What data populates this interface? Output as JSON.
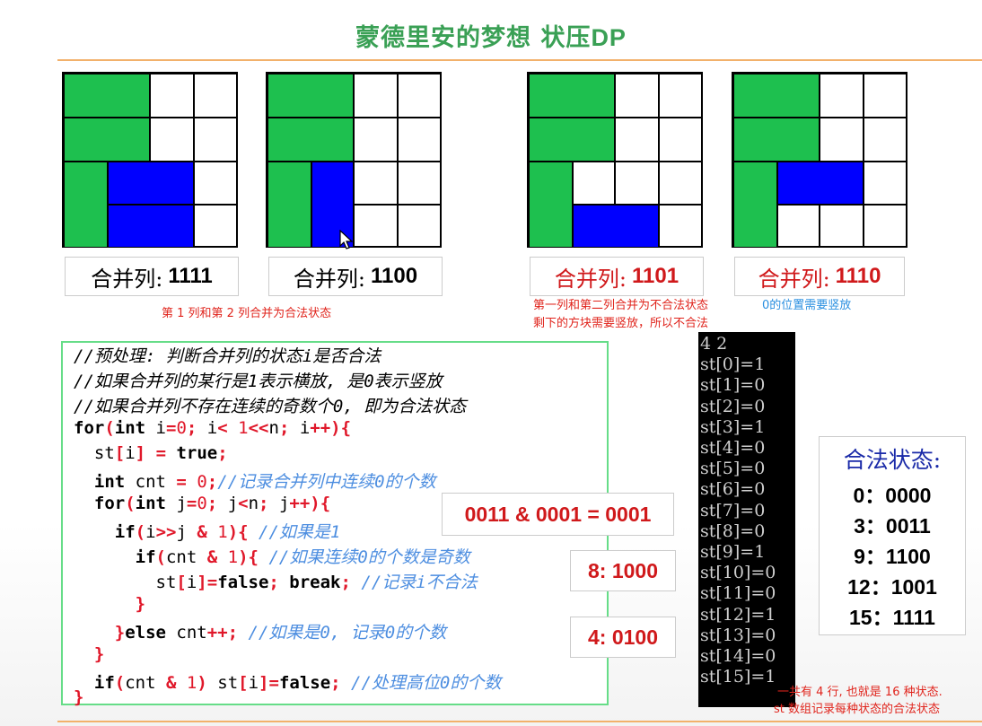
{
  "slide": {
    "title_prefix": "蒙德里安的梦想 状压",
    "title_suffix": "DP"
  },
  "grids": [
    {
      "label_prefix": "合并列:",
      "label_value": "1111",
      "label_color": "#000000"
    },
    {
      "label_prefix": "合并列:",
      "label_value": "1100",
      "label_color": "#000000"
    },
    {
      "label_prefix": "合并列:",
      "label_value": "1101",
      "label_color": "#d0191b"
    },
    {
      "label_prefix": "合并列:",
      "label_value": "1110",
      "label_color": "#d0191b"
    }
  ],
  "colors": {
    "green": "#1ec04f",
    "blue": "#0000ff",
    "accent_red": "#d0191b"
  },
  "notes": {
    "legal_merge": "第 1 列和第 2 列合并为合法状态",
    "illegal_line1": "第一列和第二列合并为不合法状态",
    "illegal_line2": "剩下的方块需要竖放，所以不合法",
    "zero_vertical": "0的位置需要竖放",
    "summary_line1": "一共有 4 行, 也就是 16 种状态.",
    "summary_line2": "st 数组记录每种状态的合法状态"
  },
  "code": {
    "c1": "//预处理: 判断合并列的状态i是否合法",
    "c2": "//如果合并列的某行是1表示横放, 是0表示竖放",
    "c3": "//如果合并列不存在连续的奇数个0, 即为合法状态",
    "c_cnt": "//记录合并列中连续0的个数",
    "c_if1": "//如果是1",
    "c_odd": "//如果连续0的个数是奇数",
    "c_illegal": "//记录i不合法",
    "c_zero": "//如果是0, 记录0的个数",
    "c_high": "//处理高位0的个数"
  },
  "console": {
    "header": "4 2",
    "lines": [
      "st[0]=1",
      "st[1]=0",
      "st[2]=0",
      "st[3]=1",
      "st[4]=0",
      "st[5]=0",
      "st[6]=0",
      "st[7]=0",
      "st[8]=0",
      "st[9]=1",
      "st[10]=0",
      "st[11]=0",
      "st[12]=1",
      "st[13]=0",
      "st[14]=0",
      "st[15]=1"
    ]
  },
  "callouts": {
    "and_expr": "0011 & 0001 = 0001",
    "eight": "8: 1000",
    "four": "4: 0100"
  },
  "legal_states": {
    "title": "合法状态:",
    "rows": [
      "0：0000",
      "3：0011",
      "9：1100",
      "12：1001",
      "15：1111"
    ]
  }
}
